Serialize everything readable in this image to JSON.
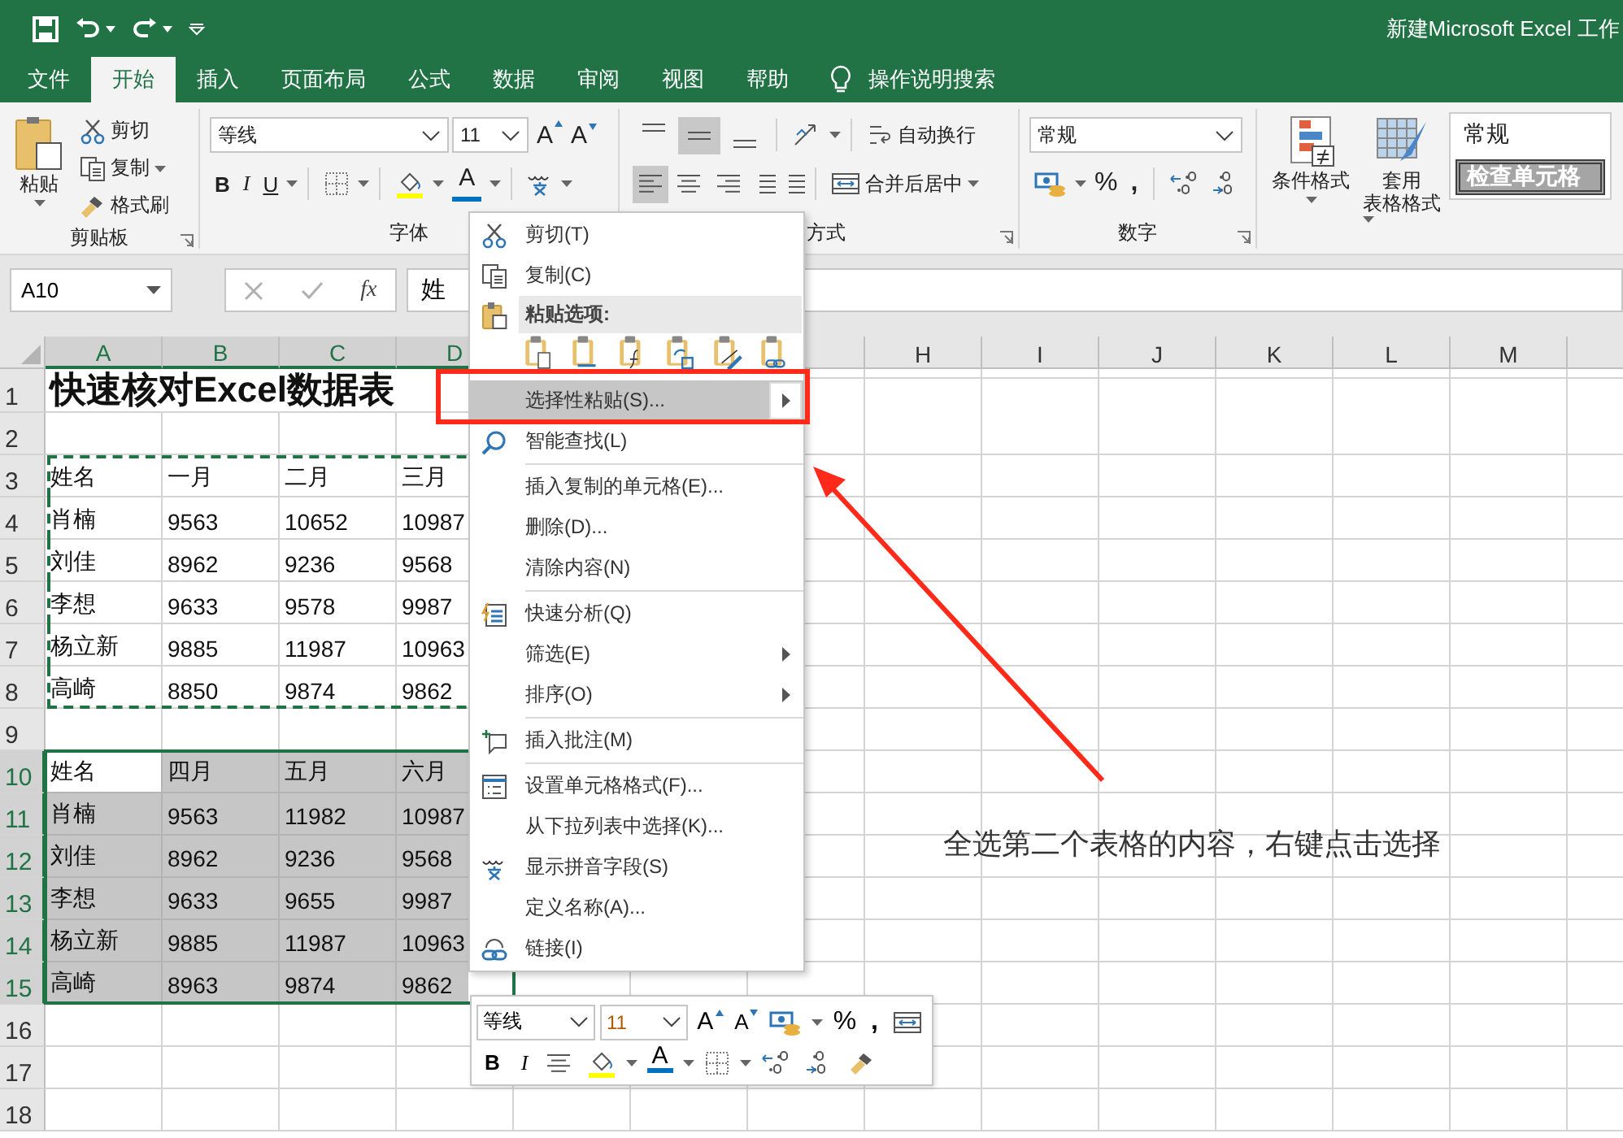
{
  "title_bar": {
    "title": "新建Microsoft Excel 工作"
  },
  "tabs": [
    {
      "label": "文件",
      "selected": false
    },
    {
      "label": "开始",
      "selected": true
    },
    {
      "label": "插入",
      "selected": false
    },
    {
      "label": "页面布局",
      "selected": false
    },
    {
      "label": "公式",
      "selected": false
    },
    {
      "label": "数据",
      "selected": false
    },
    {
      "label": "审阅",
      "selected": false
    },
    {
      "label": "视图",
      "selected": false
    },
    {
      "label": "帮助",
      "selected": false
    }
  ],
  "tell_me": {
    "label": "操作说明搜索"
  },
  "ribbon": {
    "clipboard": {
      "paste": "粘贴",
      "cut": "剪切",
      "copy": "复制",
      "format_painter": "格式刷",
      "label": "剪贴板"
    },
    "font": {
      "font_name": "等线",
      "font_size": "11",
      "grow": "A",
      "shrink": "A",
      "bold": "B",
      "italic": "I",
      "underline": "U",
      "font_color": "A",
      "label": "字体"
    },
    "alignment": {
      "vertical_buttons": [
        {
          "selected": false
        },
        {
          "selected": true
        },
        {
          "selected": false
        }
      ],
      "horizontal_buttons": [
        {
          "selected": true
        },
        {
          "selected": false
        },
        {
          "selected": false
        }
      ],
      "wrap_text": "自动换行",
      "merge_center": "合并后居中",
      "label": "方式"
    },
    "number": {
      "format": "常规",
      "percent": "%",
      "comma": ",",
      "label": "数字"
    },
    "styles": {
      "conditional_formatting": "条件格式",
      "format_as_table": [
        "套用",
        "表格格式"
      ],
      "style_normal": "常规",
      "style_check_cell": "检查单元格"
    }
  },
  "formula_bar": {
    "name_box": "A10",
    "fx": "fx",
    "content": "姓"
  },
  "sheet": {
    "columns": [
      {
        "label": "A",
        "selected": true
      },
      {
        "label": "B",
        "selected": true
      },
      {
        "label": "C",
        "selected": true
      },
      {
        "label": "D",
        "selected": true
      },
      {},
      {},
      {},
      {
        "label": "H",
        "selected": false
      },
      {
        "label": "I",
        "selected": false
      },
      {
        "label": "J",
        "selected": false
      },
      {
        "label": "K",
        "selected": false
      },
      {
        "label": "L",
        "selected": false
      },
      {
        "label": "M",
        "selected": false
      },
      {}
    ],
    "rows": [
      {
        "header": "1",
        "kind": "title",
        "selected": false,
        "copied": false,
        "cells": [
          "快速核对Excel数据表"
        ]
      },
      {
        "header": "2",
        "kind": "data",
        "selected": false,
        "copied": false,
        "cells": []
      },
      {
        "header": "3",
        "kind": "data",
        "selected": false,
        "copied": true,
        "cells": [
          "姓名",
          "一月",
          "二月",
          "三月"
        ]
      },
      {
        "header": "4",
        "kind": "data",
        "selected": false,
        "copied": true,
        "cells": [
          "肖楠",
          "9563",
          "10652",
          "10987"
        ]
      },
      {
        "header": "5",
        "kind": "data",
        "selected": false,
        "copied": true,
        "cells": [
          "刘佳",
          "8962",
          "9236",
          "9568"
        ]
      },
      {
        "header": "6",
        "kind": "data",
        "selected": false,
        "copied": true,
        "cells": [
          "李想",
          "9633",
          "9578",
          "9987"
        ]
      },
      {
        "header": "7",
        "kind": "data",
        "selected": false,
        "copied": true,
        "cells": [
          "杨立新",
          "9885",
          "11987",
          "10963"
        ]
      },
      {
        "header": "8",
        "kind": "data",
        "selected": false,
        "copied": true,
        "cells": [
          "高崎",
          "8850",
          "9874",
          "9862"
        ]
      },
      {
        "header": "9",
        "kind": "data",
        "selected": false,
        "copied": false,
        "cells": []
      },
      {
        "header": "10",
        "kind": "data",
        "selected": true,
        "copied": false,
        "cells": [
          {
            "text": "姓名",
            "active": true
          },
          "四月",
          "五月",
          "六月"
        ]
      },
      {
        "header": "11",
        "kind": "data",
        "selected": true,
        "copied": false,
        "cells": [
          "肖楠",
          "9563",
          "11982",
          "10987"
        ]
      },
      {
        "header": "12",
        "kind": "data",
        "selected": true,
        "copied": false,
        "cells": [
          "刘佳",
          "8962",
          "9236",
          "9568"
        ]
      },
      {
        "header": "13",
        "kind": "data",
        "selected": true,
        "copied": false,
        "cells": [
          "李想",
          "9633",
          "9655",
          "9987"
        ]
      },
      {
        "header": "14",
        "kind": "data",
        "selected": true,
        "copied": false,
        "cells": [
          "杨立新",
          "9885",
          "11987",
          "10963"
        ]
      },
      {
        "header": "15",
        "kind": "data",
        "selected": true,
        "copied": false,
        "cells": [
          "高崎",
          "8963",
          "9874",
          "9862"
        ]
      },
      {
        "header": "16",
        "kind": "data",
        "selected": false,
        "copied": false,
        "cells": []
      },
      {
        "header": "17",
        "kind": "data",
        "selected": false,
        "copied": false,
        "cells": []
      },
      {
        "header": "18",
        "kind": "data",
        "selected": false,
        "copied": false,
        "cells": []
      }
    ]
  },
  "context_menu": {
    "items": [
      {
        "kind": "command",
        "label": "剪切(T)",
        "selected": false,
        "submenu": false
      },
      {
        "kind": "command",
        "label": "复制(C)",
        "selected": false,
        "submenu": false
      },
      {
        "kind": "header",
        "label": "粘贴选项:"
      },
      {
        "kind": "paste_options"
      },
      {
        "kind": "command",
        "label": "选择性粘贴(S)...",
        "selected": true,
        "submenu": true
      },
      {
        "kind": "command",
        "label": "智能查找(L)",
        "selected": false,
        "submenu": false
      },
      {
        "kind": "separator"
      },
      {
        "kind": "command",
        "label": "插入复制的单元格(E)...",
        "selected": false,
        "submenu": false
      },
      {
        "kind": "command",
        "label": "删除(D)...",
        "selected": false,
        "submenu": false
      },
      {
        "kind": "command",
        "label": "清除内容(N)",
        "selected": false,
        "submenu": false
      },
      {
        "kind": "separator"
      },
      {
        "kind": "command",
        "label": "快速分析(Q)",
        "selected": false,
        "submenu": false
      },
      {
        "kind": "command",
        "label": "筛选(E)",
        "selected": false,
        "submenu": true
      },
      {
        "kind": "command",
        "label": "排序(O)",
        "selected": false,
        "submenu": true
      },
      {
        "kind": "separator"
      },
      {
        "kind": "command",
        "label": "插入批注(M)",
        "selected": false,
        "submenu": false
      },
      {
        "kind": "separator"
      },
      {
        "kind": "command",
        "label": "设置单元格格式(F)...",
        "selected": false,
        "submenu": false
      },
      {
        "kind": "command",
        "label": "从下拉列表中选择(K)...",
        "selected": false,
        "submenu": false
      },
      {
        "kind": "command",
        "label": "显示拼音字段(S)",
        "selected": false,
        "submenu": false
      },
      {
        "kind": "command",
        "label": "定义名称(A)...",
        "selected": false,
        "submenu": false
      },
      {
        "kind": "command",
        "label": "链接(I)",
        "selected": false,
        "submenu": false
      }
    ]
  },
  "mini_toolbar": {
    "font_name": "等线",
    "font_size": "11",
    "grow": "A",
    "shrink": "A",
    "percent": "%",
    "comma": ",",
    "bold": "B",
    "italic": "I",
    "font_color": "A"
  },
  "annotation": {
    "text": "全选第二个表格的内容，右键点击选择"
  }
}
